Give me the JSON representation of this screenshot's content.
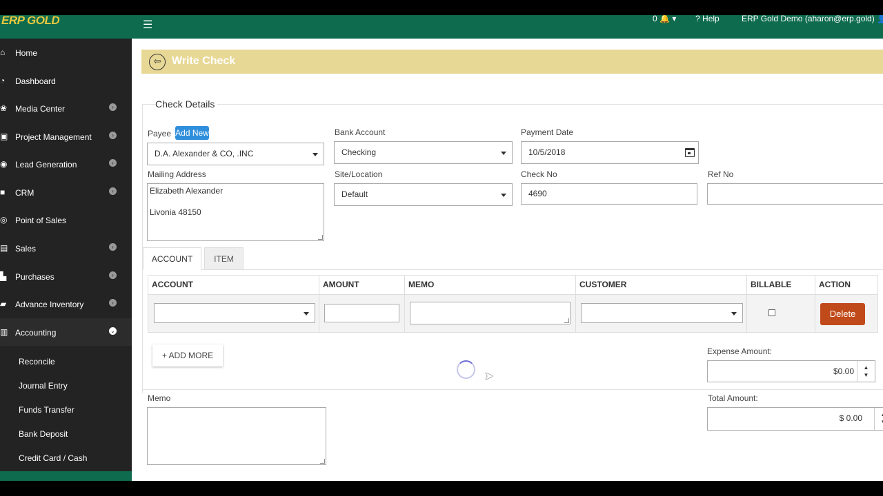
{
  "topbar": {
    "logo_text": "ERP GOLD",
    "notification_count": "0",
    "help_label": "Help",
    "user_label": "ERP Gold Demo (aharon@erp.gold)"
  },
  "sidebar": {
    "items": [
      {
        "label": "Home",
        "icon": "home-icon"
      },
      {
        "label": "Dashboard",
        "icon": "dashboard-icon"
      },
      {
        "label": "Media Center",
        "icon": "media-icon"
      },
      {
        "label": "Project Management",
        "icon": "briefcase-icon"
      },
      {
        "label": "Lead Generation",
        "icon": "lead-icon"
      },
      {
        "label": "CRM",
        "icon": "folder-icon"
      },
      {
        "label": "Point of Sales",
        "icon": "pos-icon"
      },
      {
        "label": "Sales",
        "icon": "money-icon"
      },
      {
        "label": "Purchases",
        "icon": "cart-icon"
      },
      {
        "label": "Advance Inventory",
        "icon": "truck-icon"
      },
      {
        "label": "Accounting",
        "icon": "book-icon"
      }
    ],
    "sub_items": [
      "Reconcile",
      "Journal Entry",
      "Funds Transfer",
      "Bank Deposit",
      "Credit Card / Cash"
    ]
  },
  "header": {
    "title": "Write Check"
  },
  "form": {
    "legend": "Check Details",
    "payee_label": "Payee",
    "add_new_label": "Add New",
    "payee_value": "D.A. Alexander & CO, .INC",
    "bank_account_label": "Bank Account",
    "bank_account_value": "Checking",
    "payment_date_label": "Payment Date",
    "payment_date_value": "10/5/2018",
    "mailing_address_label": "Mailing Address",
    "mailing_address_line1": "Elizabeth Alexander",
    "mailing_address_line2": "Livonia  48150",
    "site_label": "Site/Location",
    "site_value": "Default",
    "check_no_label": "Check No",
    "check_no_value": "4690",
    "ref_no_label": "Ref No",
    "ref_no_value": ""
  },
  "tabs": [
    "ACCOUNT",
    "ITEM"
  ],
  "table": {
    "headers": [
      "ACCOUNT",
      "AMOUNT",
      "MEMO",
      "CUSTOMER",
      "BILLABLE",
      "ACTION"
    ],
    "delete_label": "Delete"
  },
  "add_more_label": "+ ADD MORE",
  "expense_amount_label": "Expense Amount:",
  "expense_amount_value": "$0.00",
  "memo_label": "Memo",
  "total_amount_label": "Total Amount:",
  "total_amount_value": "$ 0.00",
  "colors": {
    "primary": "#0e6b4d",
    "header_band": "#e8d896",
    "sidebar": "#232323",
    "delete": "#c04a1a",
    "add_new": "#2f8fdc"
  }
}
